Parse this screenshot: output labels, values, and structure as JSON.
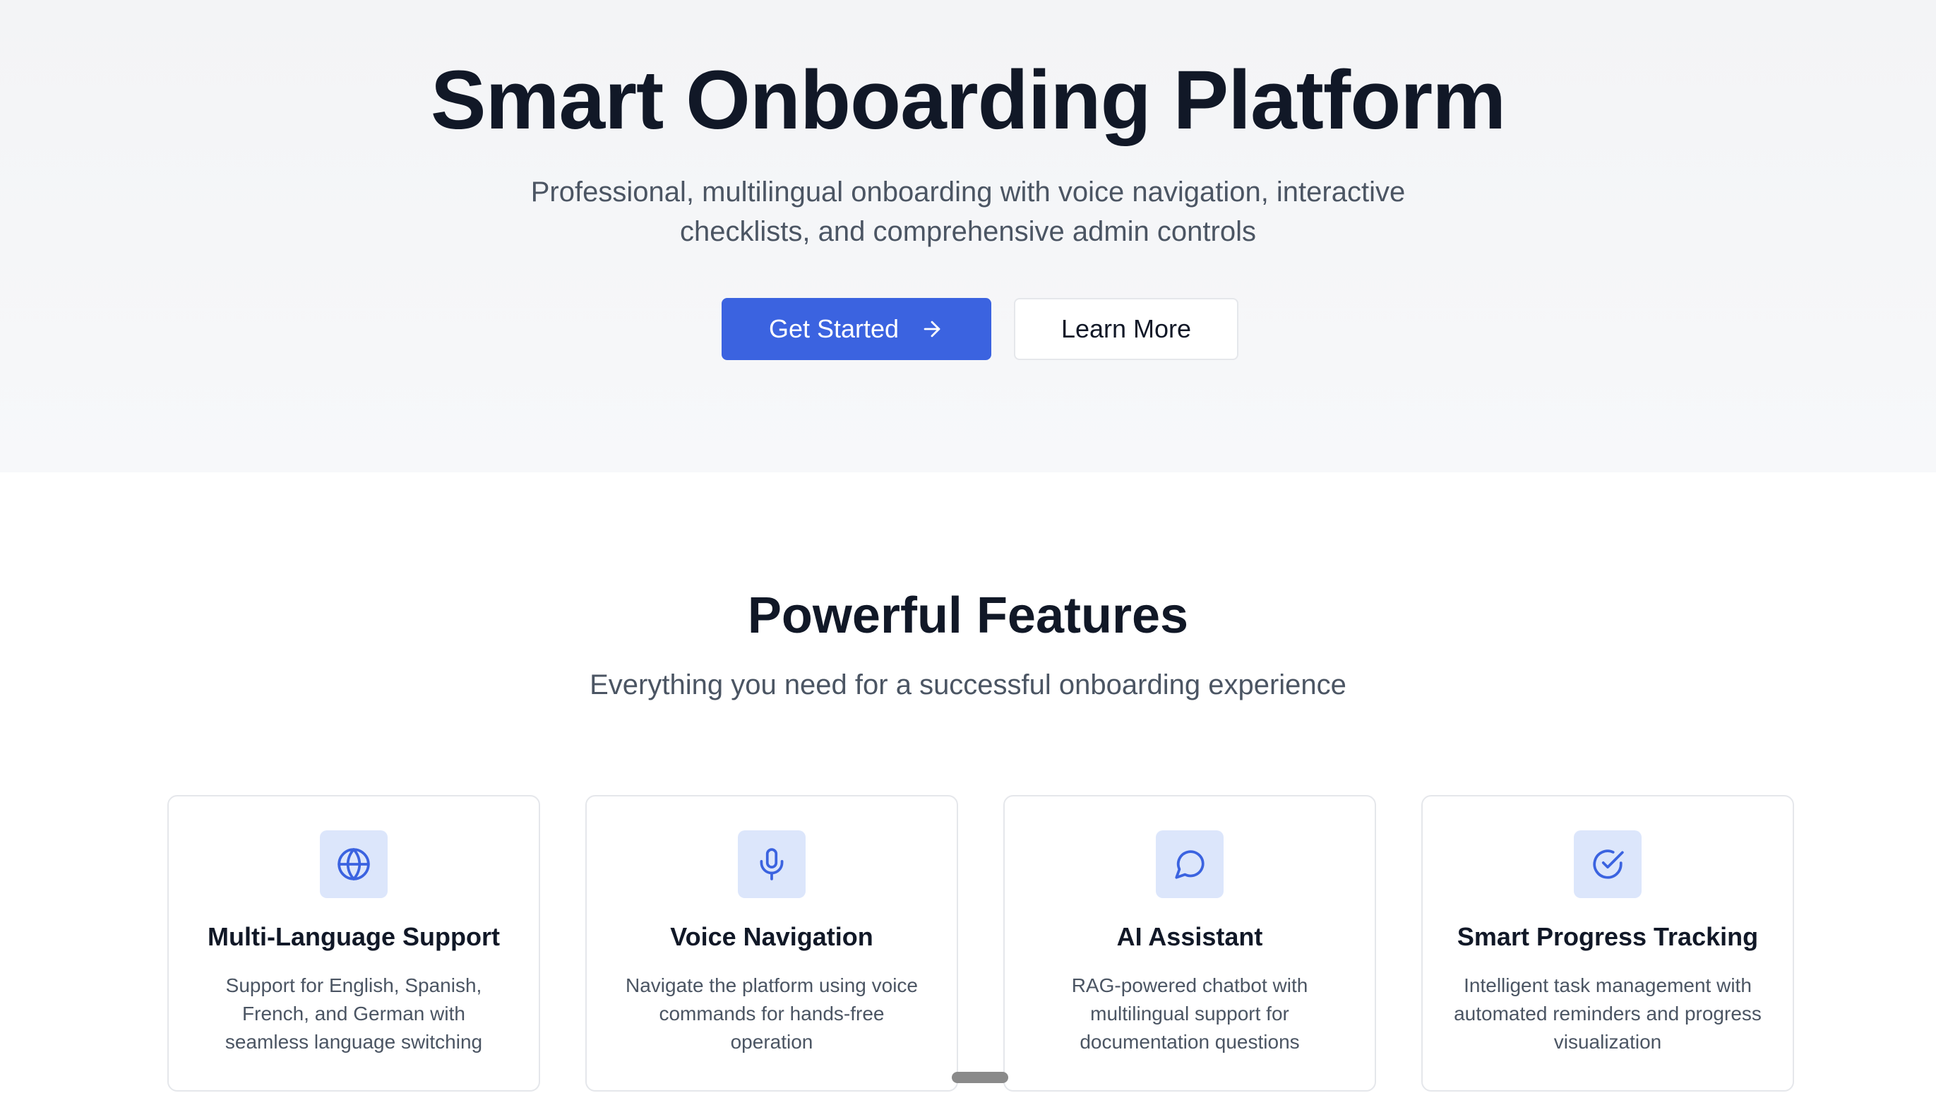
{
  "hero": {
    "title": "Smart Onboarding Platform",
    "subtitle": "Professional, multilingual onboarding with voice navigation, interactive checklists, and comprehensive admin controls",
    "primary_button": "Get Started",
    "secondary_button": "Learn More"
  },
  "features": {
    "title": "Powerful Features",
    "subtitle": "Everything you need for a successful onboarding experience",
    "cards": [
      {
        "icon": "globe-icon",
        "title": "Multi-Language Support",
        "description": "Support for English, Spanish, French, and German with seamless language switching"
      },
      {
        "icon": "microphone-icon",
        "title": "Voice Navigation",
        "description": "Navigate the platform using voice commands for hands-free operation"
      },
      {
        "icon": "chat-bubble-icon",
        "title": "AI Assistant",
        "description": "RAG-powered chatbot with multilingual support for documentation questions"
      },
      {
        "icon": "check-circle-icon",
        "title": "Smart Progress Tracking",
        "description": "Intelligent task management with automated reminders and progress visualization"
      }
    ]
  },
  "colors": {
    "primary": "#3b63e0",
    "icon_bg": "#dce6fb",
    "heading": "#111827",
    "body_text": "#4b5563"
  }
}
